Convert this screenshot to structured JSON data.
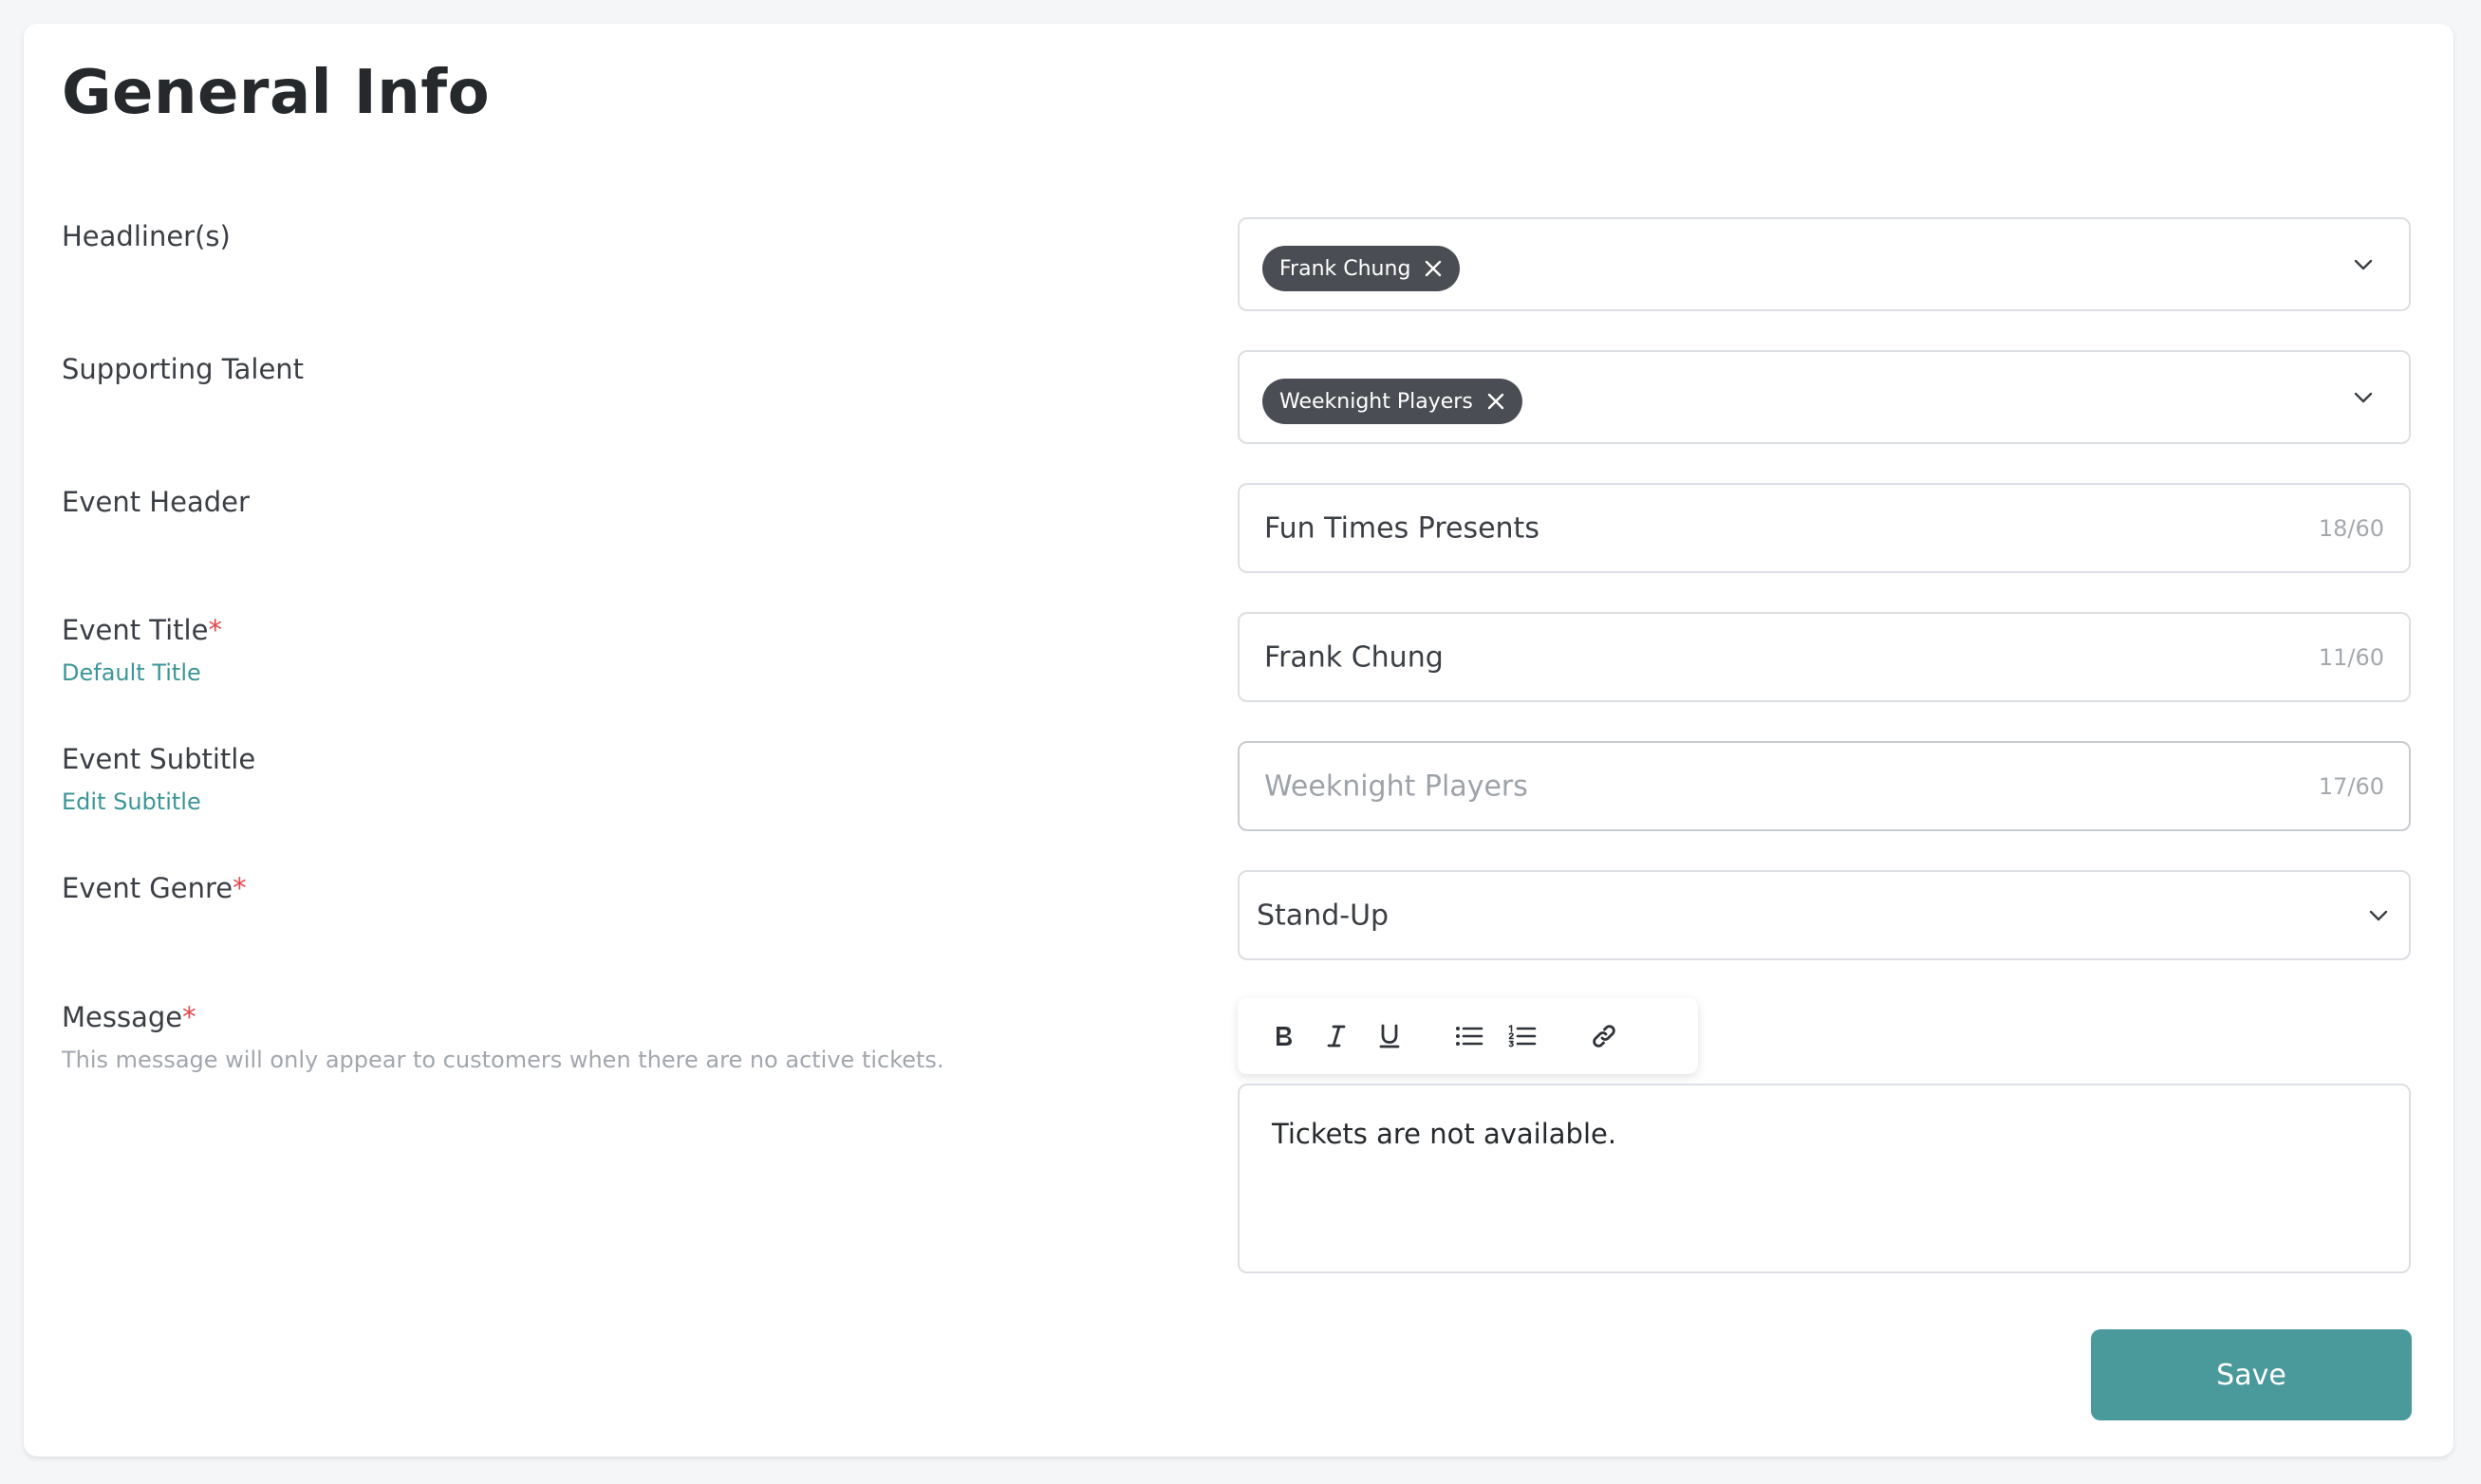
{
  "page": {
    "title": "General Info"
  },
  "fields": {
    "headliners": {
      "label": "Headliner(s)",
      "tags": [
        "Frank Chung"
      ]
    },
    "supporting_talent": {
      "label": "Supporting Talent",
      "tags": [
        "Weeknight Players"
      ]
    },
    "event_header": {
      "label": "Event Header",
      "value": "Fun Times Presents",
      "counter": "18/60"
    },
    "event_title": {
      "label": "Event Title",
      "required_mark": "*",
      "link": "Default Title",
      "value": "Frank Chung",
      "counter": "11/60"
    },
    "event_subtitle": {
      "label": "Event Subtitle",
      "link": "Edit Subtitle",
      "value": "Weeknight Players",
      "counter": "17/60"
    },
    "event_genre": {
      "label": "Event Genre",
      "required_mark": "*",
      "value": "Stand-Up"
    },
    "message": {
      "label": "Message",
      "required_mark": "*",
      "helper": "This message will only appear to customers when there are no active tickets.",
      "value": "Tickets are not available."
    }
  },
  "toolbar": {
    "buttons": [
      "bold-icon",
      "italic-icon",
      "underline-icon",
      "bulleted-list-icon",
      "numbered-list-icon",
      "link-icon"
    ]
  },
  "actions": {
    "save_label": "Save"
  },
  "colors": {
    "accent": "#4a9a9c",
    "link": "#3c9697",
    "required": "#e0474c",
    "tag_bg": "#4a4e54"
  }
}
